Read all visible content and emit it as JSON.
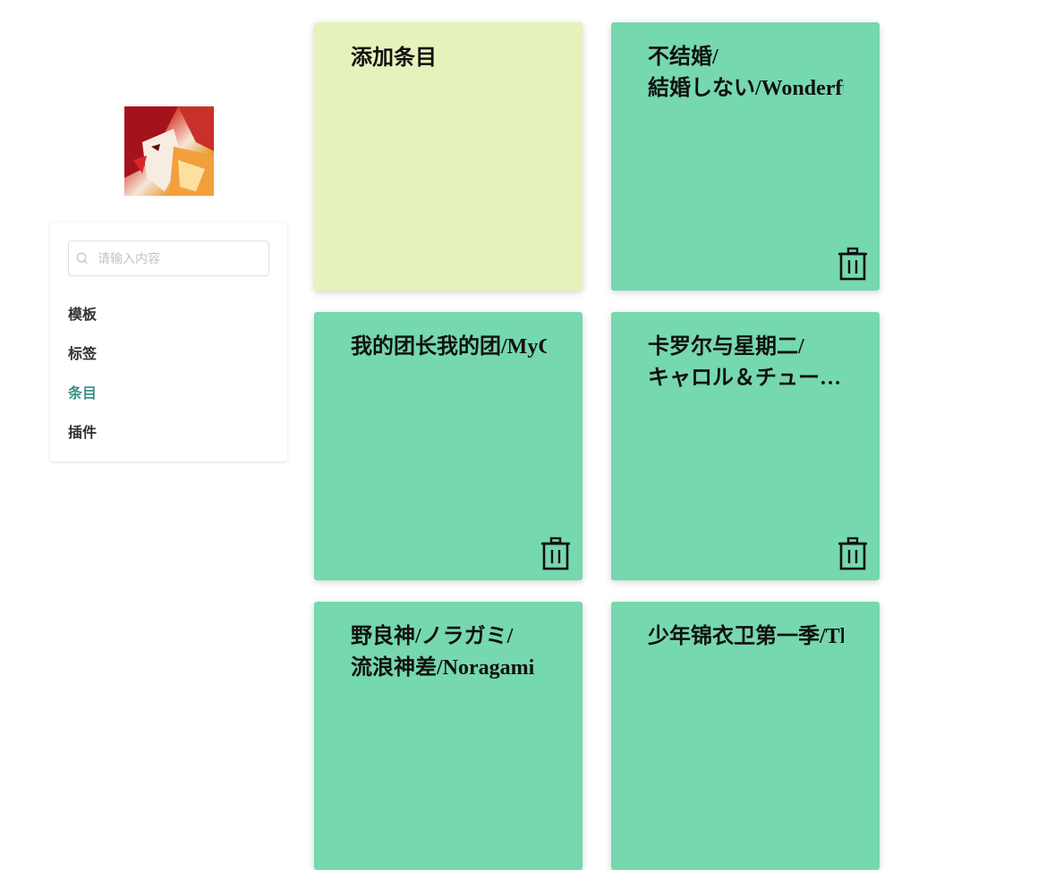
{
  "sidebar": {
    "search": {
      "placeholder": "请输入内容",
      "value": ""
    },
    "items": [
      {
        "label": "模板",
        "active": false
      },
      {
        "label": "标签",
        "active": false
      },
      {
        "label": "条目",
        "active": true
      },
      {
        "label": "插件",
        "active": false
      }
    ],
    "active_color": "#3a9187"
  },
  "cards": {
    "add_label": "添加条目",
    "items": [
      {
        "title": "不结婚/結婚しない/WonderfulSingleLife"
      },
      {
        "title": "我的团长我的团/MyChiefandMyRegiment"
      },
      {
        "title": "卡罗尔与星期二/キャロル＆チュー…"
      },
      {
        "title": "野良神/ノラガミ/流浪神差/Noragami"
      },
      {
        "title": "少年锦衣卫第一季/TheYoungImperialGuards"
      }
    ]
  },
  "colors": {
    "add_card_bg": "#e6f2bc",
    "item_card_bg": "#76d8ae"
  },
  "icons": {
    "search": "search-icon",
    "delete": "trash-icon"
  }
}
